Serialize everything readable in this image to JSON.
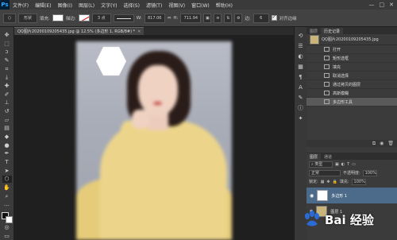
{
  "menubar": {
    "logo": "Ps",
    "items": [
      "文件(F)",
      "编辑(E)",
      "图像(I)",
      "图层(L)",
      "文字(Y)",
      "选择(S)",
      "滤镜(T)",
      "视图(V)",
      "窗口(W)",
      "帮助(H)"
    ],
    "controls": [
      "—",
      "□",
      "✕"
    ]
  },
  "optbar": {
    "mode": "形状",
    "fill_label": "填充:",
    "stroke_label": "描边:",
    "stroke_size": "3 点",
    "w_label": "W:",
    "w_value": "817.06",
    "link": "⇔",
    "h_label": "H:",
    "h_value": "711.94",
    "sides_label": "边:",
    "sides_value": "6",
    "align_edges": "对齐边缘"
  },
  "tabs": [
    {
      "label": "QQ图片20200109205435.jpg @ 12.5% (多边形 1, RGB/8#) *"
    }
  ],
  "history_panel": {
    "tabs": [
      "图层",
      "历史记录"
    ],
    "snapshot": "QQ图片20200109205435.jpg",
    "items": [
      "打开",
      "矩形选框",
      "填充",
      "取消选择",
      "通过拷贝的图层",
      "高斯模糊",
      "多边形工具"
    ],
    "selected_index": 6
  },
  "layers_panel": {
    "tabs": [
      "图层",
      "通道"
    ],
    "kind_label": "类型",
    "blend_mode": "正常",
    "opacity_label": "不透明度:",
    "opacity_value": "100%",
    "lock_label": "锁定:",
    "fill_label": "填充:",
    "fill_value": "100%",
    "layers": [
      {
        "name": "多边形 1"
      },
      {
        "name": "图层 1"
      }
    ]
  },
  "watermark": {
    "text": "Bai 经验"
  },
  "colors": {
    "accent": "#31a8ff",
    "selected_layer": "#4c6b8a",
    "hexagon": "#ffffff"
  }
}
